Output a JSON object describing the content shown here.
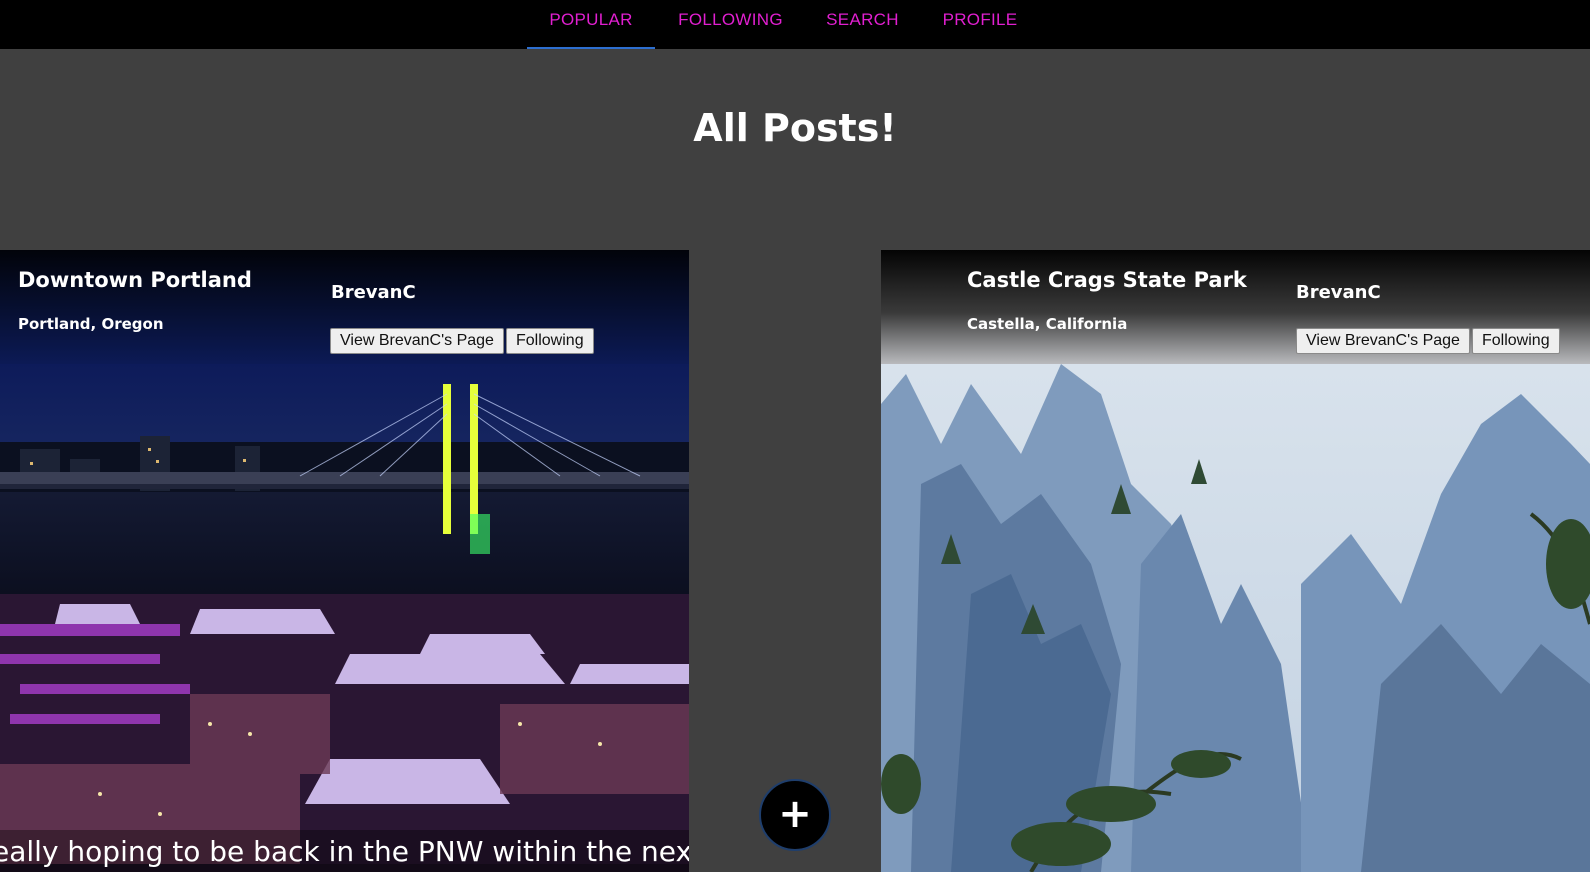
{
  "nav": {
    "tabs": [
      {
        "label": "POPULAR",
        "active": true
      },
      {
        "label": "FOLLOWING",
        "active": false
      },
      {
        "label": "SEARCH",
        "active": false
      },
      {
        "label": "PROFILE",
        "active": false
      }
    ]
  },
  "page_title": "All Posts!",
  "posts": [
    {
      "title": "Downtown Portland",
      "location": "Portland, Oregon",
      "user": "BrevanC",
      "view_button": "View BrevanC's Page",
      "follow_button": "Following",
      "caption": "eally hoping to be back in the PNW within the next"
    },
    {
      "title": "Castle Crags State Park",
      "location": "Castella, California",
      "user": "BrevanC",
      "view_button": "View BrevanC's Page",
      "follow_button": "Following"
    }
  ],
  "fab": {
    "icon": "plus-icon",
    "label": "+"
  },
  "colors": {
    "nav_text": "#e11fd0",
    "nav_active_underline": "#2d6fd0",
    "background": "#404040"
  }
}
